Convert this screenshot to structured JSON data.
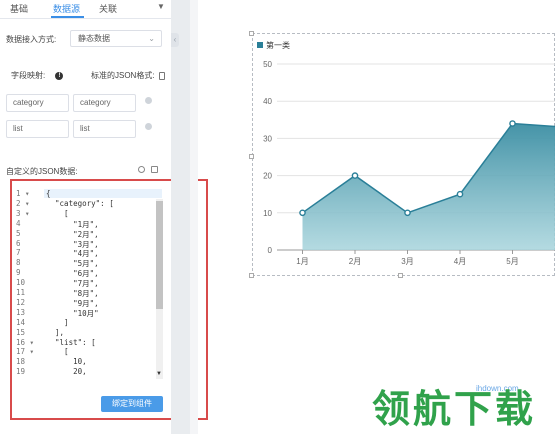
{
  "tabs": [
    "基础",
    "数据源",
    "关联"
  ],
  "data_access": {
    "label": "数据接入方式:",
    "value": "静态数据"
  },
  "mapping": {
    "field_label": "字段映射:",
    "format_label": "标准的JSON格式:",
    "rows": [
      {
        "field": "category",
        "mapped": "category"
      },
      {
        "field": "list",
        "mapped": "list"
      }
    ]
  },
  "json": {
    "label": "自定义的JSON数据:",
    "line_numbers": [
      "1",
      "2",
      "3",
      "4",
      "5",
      "6",
      "7",
      "8",
      "9",
      "10",
      "11",
      "12",
      "13",
      "14",
      "15",
      "16",
      "17",
      "18",
      "19"
    ],
    "code_lines": [
      "{",
      "  \"category\": [",
      "    [",
      "      \"1月\",",
      "      \"2月\",",
      "      \"3月\",",
      "      \"4月\",",
      "      \"5月\",",
      "      \"6月\",",
      "      \"7月\",",
      "      \"8月\",",
      "      \"9月\",",
      "      \"10月\"",
      "    ]",
      "  ],",
      "  \"list\": [",
      "    [",
      "      10,",
      "      20,"
    ]
  },
  "bind_button": "绑定到组件",
  "chart_data": {
    "type": "area",
    "categories": [
      "1月",
      "2月",
      "3月",
      "4月",
      "5月"
    ],
    "series": [
      {
        "name": "第一类",
        "values": [
          10,
          20,
          10,
          15,
          34
        ]
      }
    ],
    "next_value": 33,
    "y_ticks": [
      "0",
      "10",
      "20",
      "30",
      "40",
      "50"
    ],
    "ylim": [
      0,
      50
    ],
    "grid": true,
    "legend_position": "top-left",
    "color": "#2a7f98"
  },
  "watermark": {
    "site": "ihdown.com",
    "text": "领航下载"
  }
}
